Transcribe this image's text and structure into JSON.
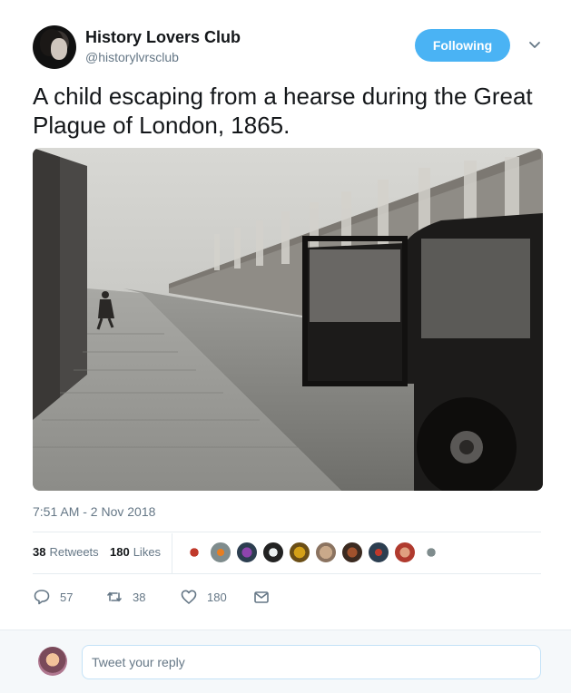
{
  "author": {
    "name": "History Lovers Club",
    "handle": "@historylvrsclub",
    "follow_label": "Following"
  },
  "tweet": {
    "text": "A child escaping from a hearse during the Great Plague of London, 1865.",
    "timestamp": "7:51 AM - 2 Nov 2018"
  },
  "stats": {
    "retweets_count": "38",
    "retweets_label": "Retweets",
    "likes_count": "180",
    "likes_label": "Likes"
  },
  "actions": {
    "reply_count": "57",
    "retweet_count": "38",
    "like_count": "180"
  },
  "reply": {
    "placeholder": "Tweet your reply"
  },
  "colors": {
    "accent": "#4ab3f4",
    "muted": "#657786",
    "text": "#14171a"
  }
}
